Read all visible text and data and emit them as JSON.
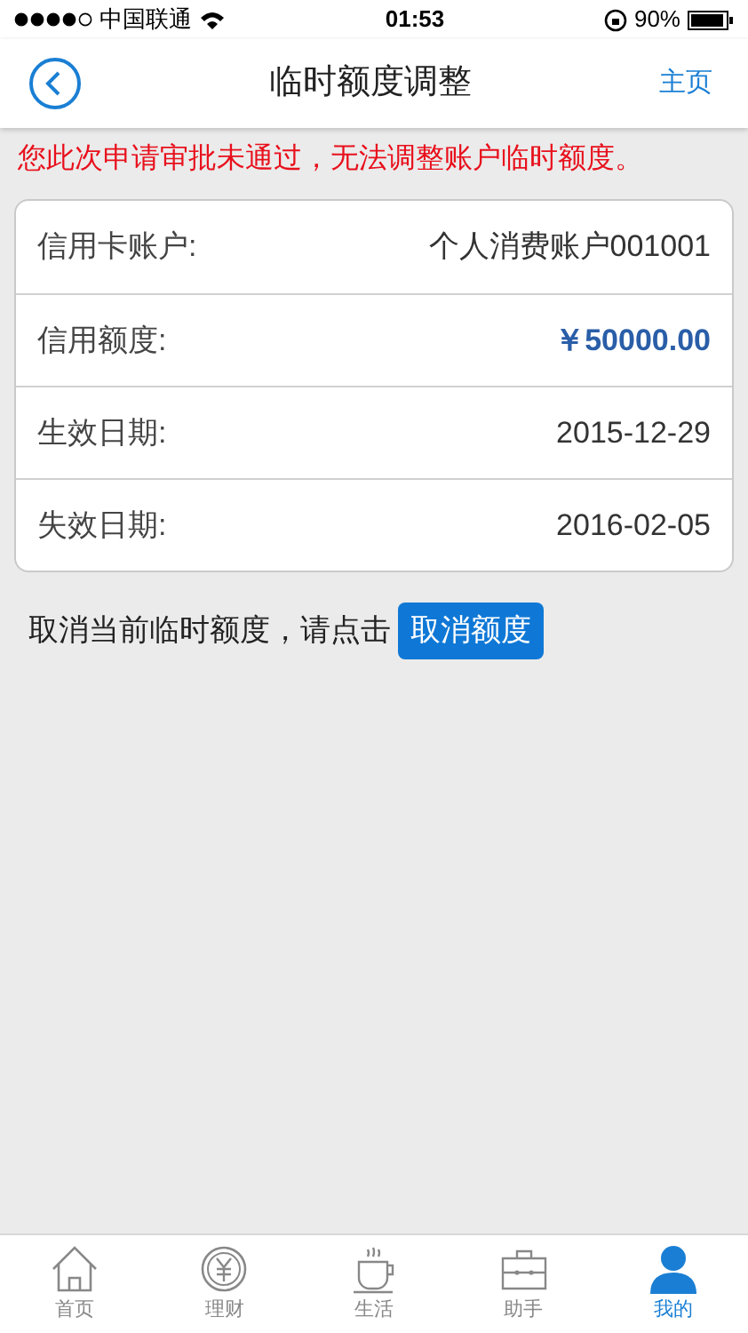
{
  "status_bar": {
    "carrier": "中国联通",
    "time": "01:53",
    "battery": "90%"
  },
  "nav": {
    "title": "临时额度调整",
    "home_link": "主页"
  },
  "message": "您此次申请审批未通过，无法调整账户临时额度。",
  "rows": [
    {
      "kind": "plain",
      "label": "信用卡账户:",
      "value": "个人消费账户001001"
    },
    {
      "kind": "amount",
      "label": "信用额度:",
      "value": "￥50000.00"
    },
    {
      "kind": "plain",
      "label": "生效日期:",
      "value": "2015-12-29"
    },
    {
      "kind": "plain",
      "label": "失效日期:",
      "value": "2016-02-05"
    }
  ],
  "cancel": {
    "prompt": "取消当前临时额度，请点击",
    "button": "取消额度"
  },
  "tabs": [
    {
      "label": "首页",
      "selected": false
    },
    {
      "label": "理财",
      "selected": false
    },
    {
      "label": "生活",
      "selected": false
    },
    {
      "label": "助手",
      "selected": false
    },
    {
      "label": "我的",
      "selected": true
    }
  ]
}
